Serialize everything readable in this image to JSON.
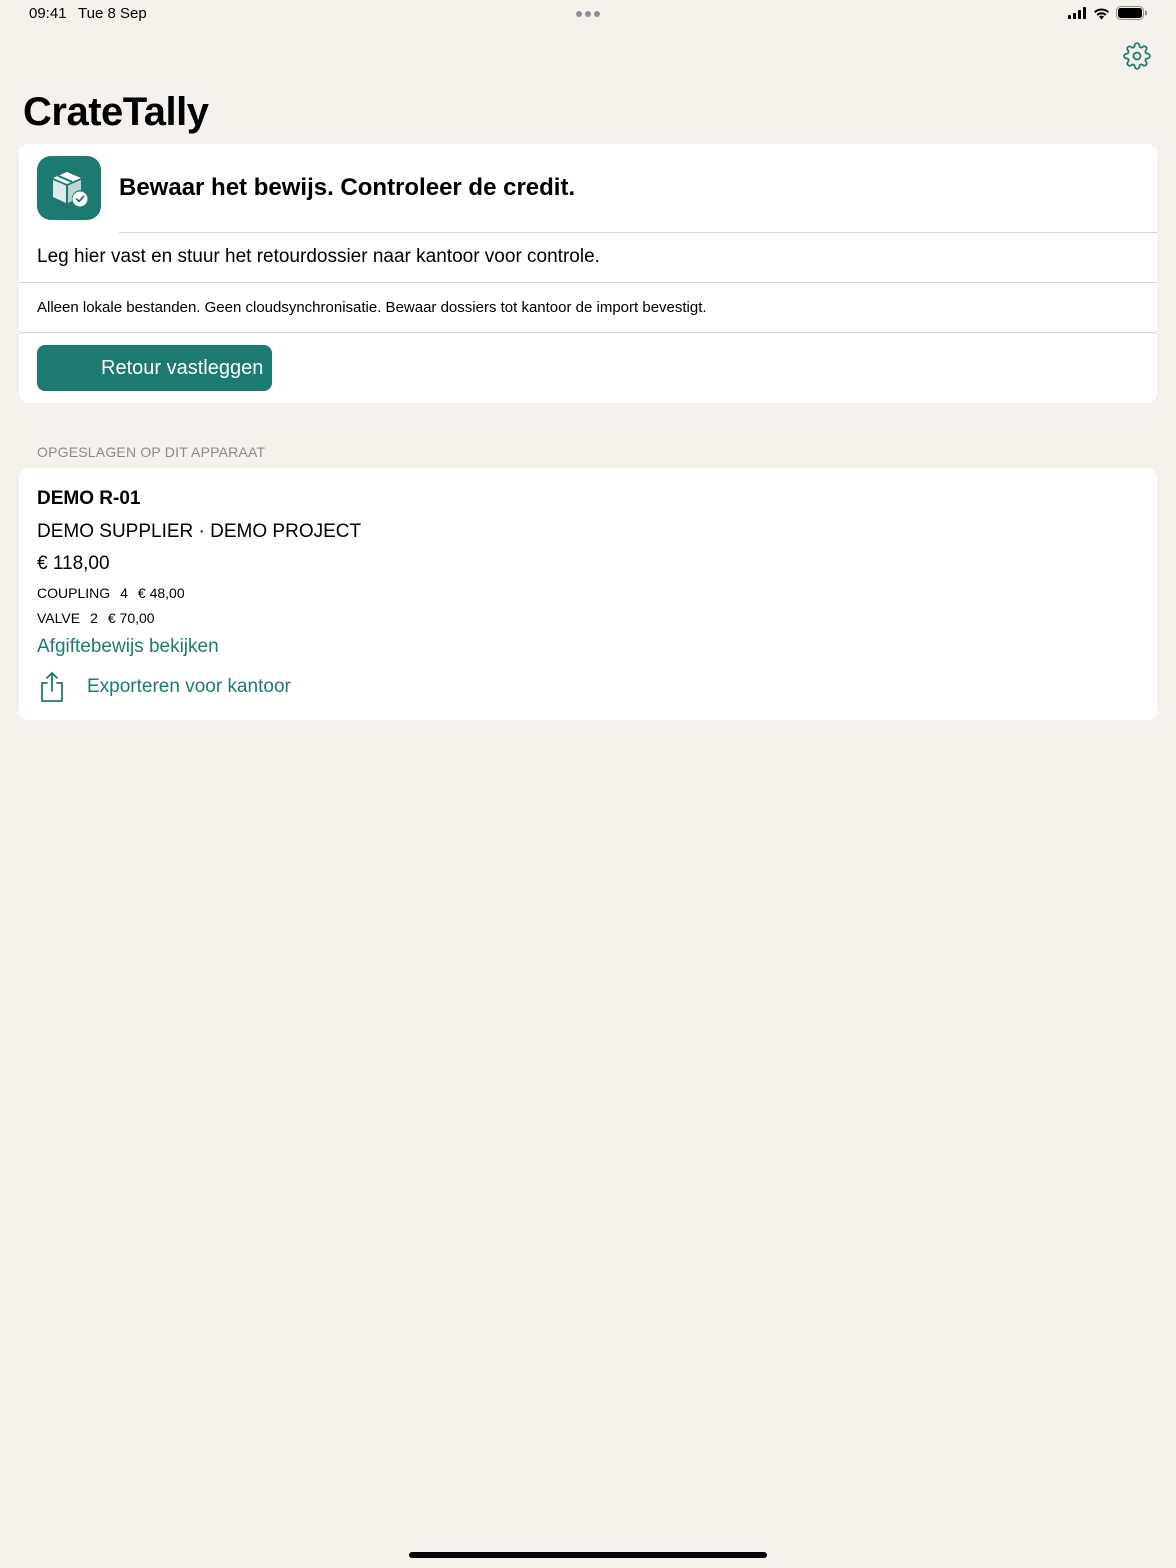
{
  "status_bar": {
    "time": "09:41",
    "date": "Tue 8 Sep"
  },
  "nav": {
    "title": "CrateTally",
    "settings_icon": "gear-icon"
  },
  "hero": {
    "icon": "box-check-icon",
    "title": "Bewaar het bewijs. Controleer de credit.",
    "description": "Leg hier vast en stuur het retourdossier naar kantoor voor controle.",
    "note": "Alleen lokale bestanden. Geen cloudsynchronisatie. Bewaar dossiers tot kantoor de import bevestigt.",
    "primary_button": "Retour vastleggen"
  },
  "saved": {
    "section_header": "OPGESLAGEN OP DIT APPARAAT",
    "records": [
      {
        "id": "DEMO R-01",
        "subtitle": "DEMO SUPPLIER · DEMO PROJECT",
        "total": "€ 118,00",
        "lines": [
          {
            "item": "COUPLING",
            "qty": "4",
            "amount": "€ 48,00"
          },
          {
            "item": "VALVE",
            "qty": "2",
            "amount": "€ 70,00"
          }
        ],
        "view_link": "Afgiftebewijs bekijken",
        "export_label": "Exporteren voor kantoor",
        "export_icon": "share-icon"
      }
    ]
  },
  "colors": {
    "accent": "#1c7a70",
    "background": "#f5f2ec",
    "card": "#ffffff"
  }
}
